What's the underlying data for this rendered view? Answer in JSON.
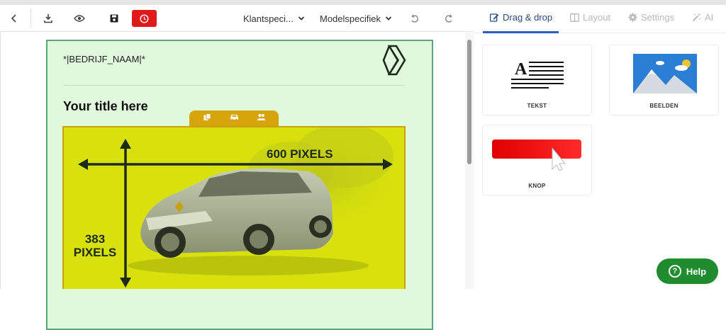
{
  "toolbar": {
    "dropdown_1": "Klantspeci...",
    "dropdown_2": "Modelspecifiek"
  },
  "email": {
    "company_placeholder": "*|BEDRIJF_NAAM|*",
    "title": "Your title here",
    "image_width_label": "600 PIXELS",
    "image_height_value": "383",
    "image_height_unit": "PIXELS"
  },
  "right_panel": {
    "tabs": [
      {
        "label": "Drag & drop"
      },
      {
        "label": "Layout"
      },
      {
        "label": "Settings"
      },
      {
        "label": "AI"
      }
    ],
    "cards": [
      {
        "label": "TEKST"
      },
      {
        "label": "BEELDEN"
      },
      {
        "label": "KNOP"
      }
    ]
  },
  "help": {
    "label": "Help"
  },
  "colors": {
    "accent_red": "#e01a1a",
    "email_bg": "#e0f8dc",
    "email_border": "#5aa579",
    "image_tint": "#d8e10c",
    "tab_active": "#2a4a7f",
    "help_green": "#1f8c2d"
  }
}
